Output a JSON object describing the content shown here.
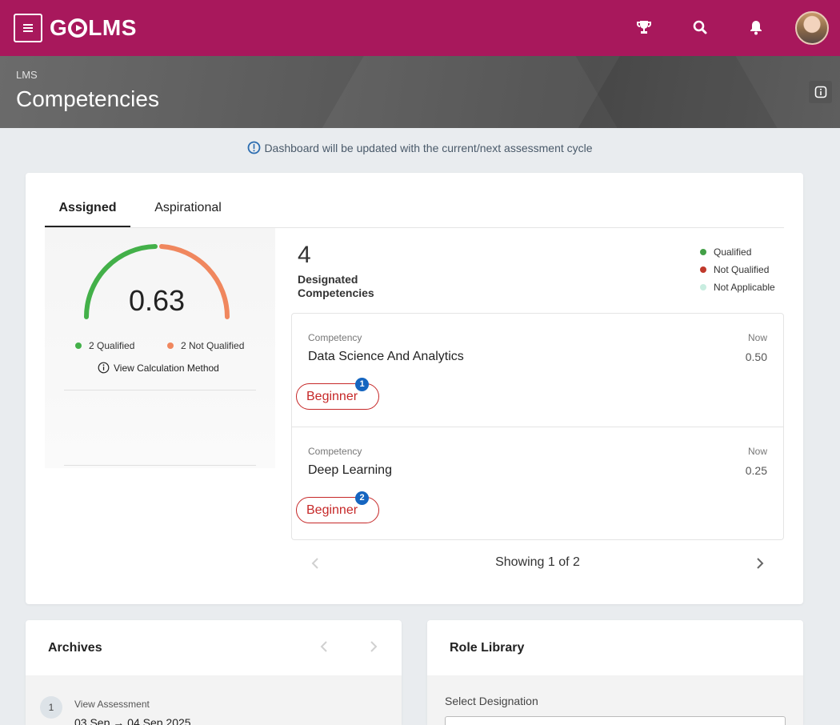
{
  "app": {
    "logo_text": "GOLMS",
    "logo_left": "G",
    "logo_right": "LMS"
  },
  "topbar": {
    "menu_icon": "hamburger-icon",
    "icons": [
      "trophy-icon",
      "search-icon",
      "bell-icon"
    ],
    "brand_color": "#a8185c"
  },
  "header": {
    "breadcrumb": "LMS",
    "title": "Competencies"
  },
  "notice": "Dashboard will be updated with the current/next assessment cycle",
  "tabs": [
    {
      "label": "Assigned",
      "active": true
    },
    {
      "label": "Aspirational",
      "active": false
    }
  ],
  "score": {
    "value": "0.63",
    "qualified_label": "2 Qualified",
    "not_qualified_label": "2 Not Qualified",
    "qualified_count": 2,
    "not_qualified_count": 2,
    "calc_link": "View Calculation Method",
    "colors": {
      "qualified": "#43b049",
      "not_qualified": "#f0875e"
    }
  },
  "summary": {
    "count": "4",
    "label": "Designated Competencies"
  },
  "status_legend": [
    {
      "label": "Qualified",
      "color": "#43a047"
    },
    {
      "label": "Not Qualified",
      "color": "#c0392b"
    },
    {
      "label": "Not Applicable",
      "color": "#c8ede0"
    }
  ],
  "competencies": [
    {
      "caption": "Competency",
      "name": "Data Science And Analytics",
      "now_caption": "Now",
      "now_value": "0.50",
      "level": "Beginner",
      "badge": "1"
    },
    {
      "caption": "Competency",
      "name": "Deep Learning",
      "now_caption": "Now",
      "now_value": "0.25",
      "level": "Beginner",
      "badge": "2"
    }
  ],
  "pager": {
    "text": "Showing 1 of 2"
  },
  "archives": {
    "title": "Archives",
    "item_number": "1",
    "item_label": "View Assessment",
    "item_dates": "03 Sep → 04 Sep 2025"
  },
  "role_library": {
    "title": "Role Library",
    "select_label": "Select Designation"
  }
}
